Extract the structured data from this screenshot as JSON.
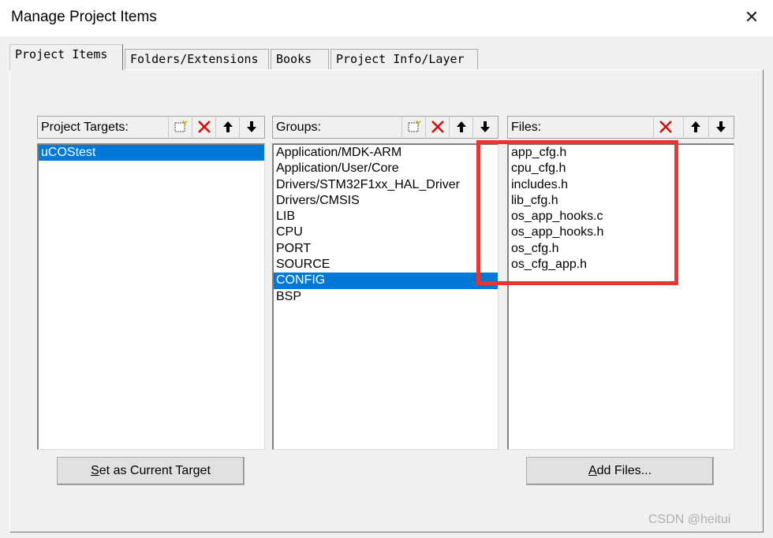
{
  "window": {
    "title": "Manage Project Items",
    "close_symbol": "✕"
  },
  "tabs": [
    {
      "label": "Project Items",
      "active": true
    },
    {
      "label": "Folders/Extensions",
      "active": false
    },
    {
      "label": "Books",
      "active": false
    },
    {
      "label": "Project Info/Layer",
      "active": false
    }
  ],
  "targets": {
    "header_label": "Project Targets:",
    "items": [
      "uCOStest"
    ],
    "selected_index": 0
  },
  "groups": {
    "header_label": "Groups:",
    "items": [
      "Application/MDK-ARM",
      "Application/User/Core",
      "Drivers/STM32F1xx_HAL_Driver",
      "Drivers/CMSIS",
      "LIB",
      "CPU",
      "PORT",
      "SOURCE",
      "CONFIG",
      "BSP"
    ],
    "selected_index": 8
  },
  "files": {
    "header_label": "Files:",
    "items": [
      "app_cfg.h",
      "cpu_cfg.h",
      "includes.h",
      "lib_cfg.h",
      "os_app_hooks.c",
      "os_app_hooks.h",
      "os_cfg.h",
      "os_cfg_app.h"
    ]
  },
  "buttons": {
    "set_target_mnemonic": "S",
    "set_target_rest": "et as Current Target",
    "add_files_mnemonic": "A",
    "add_files_rest": "dd Files..."
  },
  "icons": {
    "new": "new-item-icon",
    "delete": "delete-x-icon",
    "up": "move-up-arrow-icon",
    "down": "move-down-arrow-icon"
  },
  "colors": {
    "selection": "#0078d7",
    "highlight_box": "#ee3333",
    "dialog_bg": "#f0f0f0"
  },
  "watermark": "CSDN @heitui"
}
